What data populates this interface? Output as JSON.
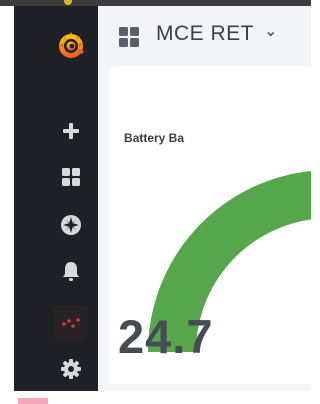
{
  "header": {
    "dashboard_title": "MCE RET",
    "title_caret": "⌄"
  },
  "sidebar": {
    "items": [
      {
        "name": "create",
        "icon": "plus-icon"
      },
      {
        "name": "dashboards",
        "icon": "grid-icon"
      },
      {
        "name": "explore",
        "icon": "compass-icon"
      },
      {
        "name": "alerting",
        "icon": "bell-icon"
      },
      {
        "name": "active-dots",
        "icon": "graph-dots-icon"
      },
      {
        "name": "configuration",
        "icon": "gear-icon"
      }
    ],
    "logo": "grafana-logo-icon"
  },
  "panel": {
    "title": "Battery Ba",
    "value": "24.7",
    "gauge_fill_fraction": 0.82,
    "gauge_color": "#56a64b",
    "gauge_track_color": "#e3e4e6"
  },
  "colors": {
    "sidebar_bg": "#1f2126",
    "main_bg": "#f4f5f8",
    "accent": "#f46800"
  }
}
